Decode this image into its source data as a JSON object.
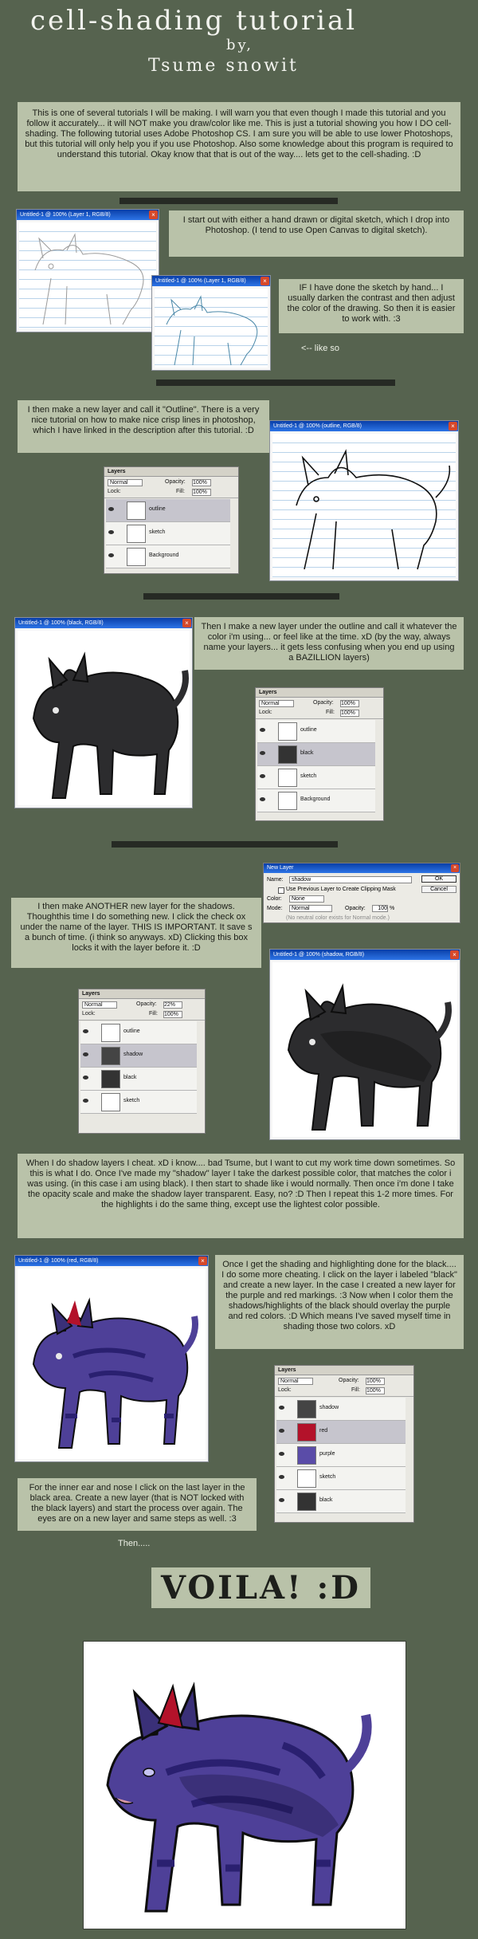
{
  "header": {
    "title": "cell-shading tutorial",
    "byline": "by,",
    "author": "Tsume snowit"
  },
  "intro": "This is one of several tutorials I will be making. I will warn you that even though I made this tutorial and you follow it accurately... it will NOT make you draw/color like me. This is just a tutorial showing you how I DO cell-shading. The following tutorial uses Adobe Photoshop CS. I am sure you will be able to use lower Photoshops, but this tutorial will only help you if you use Photoshop. Also some knowledge about this program is required to understand this tutorial. Okay know that that is out of the way.... lets get to the cell-shading. :D",
  "step1": {
    "note": "I start out with either a hand drawn or digital sketch, which I drop into Photoshop. (I tend to use Open Canvas to digital sketch).",
    "note2": "IF I have done the sketch by hand... I usually darken the contrast and then adjust the color of the drawing. So then it is easier to work with. :3",
    "like_so": "<-- like so",
    "win1_title": "Untitled-1 @ 100% (Layer 1, RGB/8)",
    "win2_title": "Untitled-1 @ 100% (Layer 1, RGB/8)"
  },
  "step2": {
    "note": "I then make a new layer and call it \"Outline\". There is a very nice tutorial on how to make nice crisp lines in photoshop, which I have linked in the description after this tutorial. :D",
    "win_title": "Untitled-1 @ 100% (outline, RGB/8)",
    "layers_title": "Layers",
    "blend": "Normal",
    "opacity_label": "Opacity:",
    "opacity": "100%",
    "lock_label": "Lock:",
    "fill_label": "Fill:",
    "fill": "100%",
    "layer_names": [
      "outline",
      "sketch",
      "Background"
    ]
  },
  "step3": {
    "note": "Then I make a new layer under the outline and call it whatever the color i'm using... or feel like at the time. xD (by the way, always name your layers... it gets less confusing when you end up using a BAZILLION layers)",
    "win_title": "Untitled-1 @ 100% (black, RGB/8)",
    "layers_title": "Layers",
    "blend": "Normal",
    "opacity_label": "Opacity:",
    "opacity": "100%",
    "lock_label": "Lock:",
    "fill_label": "Fill:",
    "fill": "100%",
    "layer_names": [
      "outline",
      "black",
      "sketch",
      "Background"
    ]
  },
  "step4": {
    "note": "I then make ANOTHER new layer for the shadows. Thoughthis time I do something new. I click the check ox under the name of the layer. THIS IS IMPORTANT. It save s a bunch of time. (i think so anyways. xD) Clicking this box locks it with the layer before it. :D",
    "dialog_title": "New Layer",
    "name_label": "Name:",
    "name_value": "shadow",
    "ok_label": "OK",
    "cancel_label": "Cancel",
    "checkbox_label": "Use Previous Layer to Create Clipping Mask",
    "color_label": "Color:",
    "color_value": "None",
    "mode_label": "Mode:",
    "mode_value": "Normal",
    "opacity_label": "Opacity:",
    "opacity_value": "100",
    "pct": "%",
    "neutral_label": "(No neutral color exists for Normal mode.)",
    "win_title": "Untitled-1 @ 100% (shadow, RGB/8)",
    "layers_title": "Layers",
    "blend": "Normal",
    "opacity": "22%",
    "lock_label": "Lock:",
    "fill_label": "Fill:",
    "fill": "100%",
    "layer_names": [
      "outline",
      "shadow",
      "black",
      "sketch"
    ]
  },
  "step5": {
    "note": "When I do shadow layers I cheat. xD i know.... bad Tsume, but I want to cut my work time down sometimes. So this is what I do. Once I've made my \"shadow\" layer I take the darkest possible color, that matches the color i was using. (in this case i am using black). I then start to shade like i would normally. Then once i'm done I take the opacity scale and make the shadow layer transparent. Easy, no? :D Then I repeat this 1-2 more times. For the highlights i do the same thing, except use the lightest color possible."
  },
  "step6": {
    "note": "Once I get the shading and highlighting done for the black.... I do some more cheating. I click on the layer i labeled \"black\" and create a new layer. In the case I created a new layer for the purple and red markings. :3 Now when I color them the shadows/highlights of the black should overlay the purple and red colors. :D Which means I've saved myself time in shading those two colors. xD",
    "win_title": "Untitled-1 @ 100% (red, RGB/8)",
    "layers_title": "Layers",
    "blend": "Normal",
    "opacity_label": "Opacity:",
    "opacity": "100%",
    "lock_label": "Lock:",
    "fill_label": "Fill:",
    "fill": "100%",
    "layer_names": [
      "shadow",
      "red",
      "purple",
      "sketch",
      "black"
    ]
  },
  "step7": {
    "note": "For the inner ear and nose I click on the last layer in the black area. Create a new layer (that is NOT locked with the black layers) and start the process over again. The eyes are on a new layer and same steps as well. :3",
    "then": "Then....."
  },
  "finale": {
    "voila": "VOILA! :D"
  },
  "colors": {
    "background": "#56634f",
    "note_bg": "#b9c2a9",
    "divider": "#262a24",
    "wolf_black": "#2c2c2e",
    "wolf_purple": "#5a4ca8",
    "wolf_red": "#b3122a"
  }
}
